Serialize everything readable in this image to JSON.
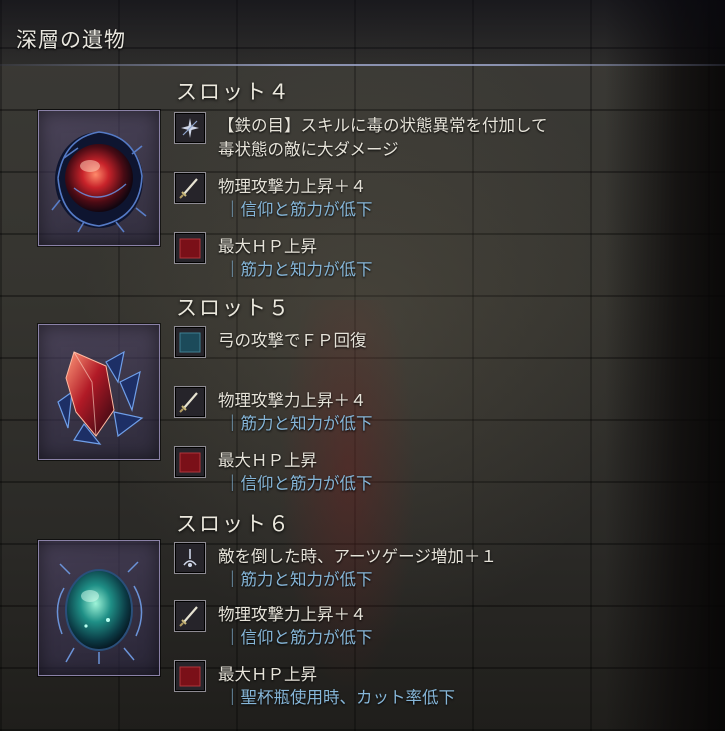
{
  "header": {
    "title": "深層の遺物"
  },
  "slots": [
    {
      "title": "スロット４",
      "relic_icon": "red-crystal-orb-relic-icon",
      "effects": [
        {
          "icon": "skill-sparkle-icon",
          "lines": [
            "【鉄の目】スキルに毒の状態異常を付加して",
            "毒状態の敵に大ダメージ"
          ],
          "sub": ""
        },
        {
          "icon": "sword-icon",
          "lines": [
            "物理攻撃力上昇＋４"
          ],
          "sub": "｜信仰と筋力が低下"
        },
        {
          "icon": "red-square-icon",
          "lines": [
            "最大ＨＰ上昇"
          ],
          "sub": "｜筋力と知力が低下"
        }
      ]
    },
    {
      "title": "スロット５",
      "relic_icon": "red-shard-relic-icon",
      "effects": [
        {
          "icon": "teal-square-icon",
          "lines": [
            "弓の攻撃でＦＰ回復"
          ],
          "sub": ""
        },
        {
          "icon": "sword-icon",
          "lines": [
            "物理攻撃力上昇＋４"
          ],
          "sub": "｜筋力と知力が低下"
        },
        {
          "icon": "red-square-icon",
          "lines": [
            "最大ＨＰ上昇"
          ],
          "sub": "｜信仰と筋力が低下"
        }
      ]
    },
    {
      "title": "スロット６",
      "relic_icon": "green-egg-relic-icon",
      "effects": [
        {
          "icon": "arts-gauge-icon",
          "lines": [
            "敵を倒した時、アーツゲージ増加＋１"
          ],
          "sub": "｜筋力と知力が低下"
        },
        {
          "icon": "sword-icon",
          "lines": [
            "物理攻撃力上昇＋４"
          ],
          "sub": "｜信仰と筋力が低下"
        },
        {
          "icon": "red-square-icon",
          "lines": [
            "最大ＨＰ上昇"
          ],
          "sub": "｜聖杯瓶使用時、カット率低下"
        }
      ]
    }
  ],
  "colors": {
    "accent_blue": "#86b6d8",
    "frame_purple": "#8b82a8",
    "text": "#e6e3d9"
  }
}
